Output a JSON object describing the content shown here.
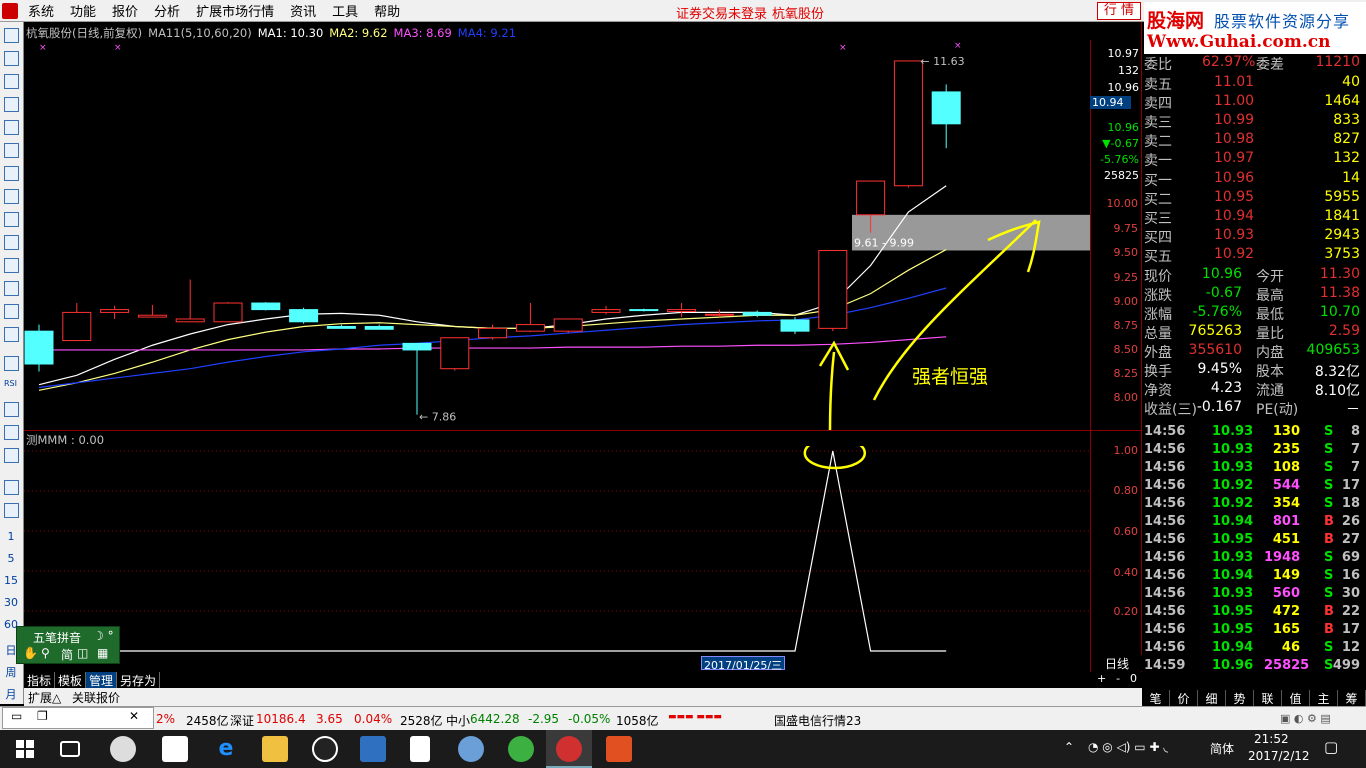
{
  "menu": {
    "items": [
      "系统",
      "功能",
      "报价",
      "分析",
      "扩展市场行情",
      "资讯",
      "工具",
      "帮助"
    ],
    "notice": "证券交易未登录",
    "stock_name": "杭氧股份",
    "quote_button": "行 情"
  },
  "brand": {
    "line1": "股海网",
    "line2": "股票软件资源分享",
    "line3": "Www.Guhai.com.cn"
  },
  "chart": {
    "title": "杭氧股份(日线,前复权)",
    "ma_params": "MA11(5,10,60,20)",
    "ma1": "MA1: 10.30",
    "ma2": "MA2: 9.62",
    "ma3": "MA3: 8.69",
    "ma4": "MA4: 9.21",
    "high_label": "11.63",
    "low_label": "7.86",
    "zone_label": "9.61 - 9.99",
    "annotation": "强者恒强",
    "price_box": [
      "10.97",
      "132",
      "10.96",
      "10.94",
      "10.96",
      "▼-0.67",
      "-5.76%",
      "25825"
    ],
    "y_axis": [
      "10.00",
      "9.75",
      "9.50",
      "9.25",
      "9.00",
      "8.75",
      "8.50",
      "8.25",
      "8.00"
    ],
    "sub_title": "测MMM : 0.00",
    "sub_y_axis": [
      "1.00",
      "0.80",
      "0.60",
      "0.40",
      "0.20"
    ],
    "date_cursor": "2017/01/25/三",
    "period": "日线",
    "colors": {
      "up": "#ff3232",
      "down": "#54ffff",
      "ma1": "#ffffff",
      "ma2": "#ffff80",
      "ma3": "#ff50ff",
      "ma4": "#2040ff",
      "accent": "#ffff00",
      "zone": "#999999"
    }
  },
  "chart_data": {
    "type": "candlestick",
    "title": "",
    "candles": [
      {
        "o": 8.75,
        "h": 8.82,
        "l": 8.32,
        "c": 8.4
      },
      {
        "o": 8.65,
        "h": 9.05,
        "l": 8.65,
        "c": 8.95
      },
      {
        "o": 8.95,
        "h": 9.02,
        "l": 8.88,
        "c": 8.98
      },
      {
        "o": 8.9,
        "h": 9.03,
        "l": 8.9,
        "c": 8.92
      },
      {
        "o": 8.85,
        "h": 9.3,
        "l": 8.85,
        "c": 8.88
      },
      {
        "o": 8.85,
        "h": 9.06,
        "l": 8.85,
        "c": 9.05
      },
      {
        "o": 9.05,
        "h": 9.06,
        "l": 8.97,
        "c": 8.98
      },
      {
        "o": 8.98,
        "h": 9.0,
        "l": 8.83,
        "c": 8.85
      },
      {
        "o": 8.8,
        "h": 8.82,
        "l": 8.78,
        "c": 8.78
      },
      {
        "o": 8.8,
        "h": 8.82,
        "l": 8.78,
        "c": 8.77
      },
      {
        "o": 8.62,
        "h": 8.62,
        "l": 7.86,
        "c": 8.55
      },
      {
        "o": 8.35,
        "h": 8.67,
        "l": 8.33,
        "c": 8.68
      },
      {
        "o": 8.68,
        "h": 8.82,
        "l": 8.66,
        "c": 8.78
      },
      {
        "o": 8.75,
        "h": 9.05,
        "l": 8.74,
        "c": 8.82
      },
      {
        "o": 8.75,
        "h": 8.88,
        "l": 8.73,
        "c": 8.88
      },
      {
        "o": 8.95,
        "h": 9.02,
        "l": 8.93,
        "c": 8.98
      },
      {
        "o": 8.98,
        "h": 8.99,
        "l": 8.96,
        "c": 8.97
      },
      {
        "o": 8.96,
        "h": 9.05,
        "l": 8.9,
        "c": 8.98
      },
      {
        "o": 8.92,
        "h": 8.98,
        "l": 8.9,
        "c": 8.93
      },
      {
        "o": 8.95,
        "h": 8.97,
        "l": 8.9,
        "c": 8.92
      },
      {
        "o": 8.87,
        "h": 8.9,
        "l": 8.72,
        "c": 8.75
      },
      {
        "o": 8.78,
        "h": 9.61,
        "l": 8.75,
        "c": 9.61
      },
      {
        "o": 9.99,
        "h": 10.35,
        "l": 9.8,
        "c": 10.35
      },
      {
        "o": 10.3,
        "h": 11.63,
        "l": 10.28,
        "c": 11.63
      },
      {
        "o": 11.3,
        "h": 11.38,
        "l": 10.7,
        "c": 10.96
      }
    ],
    "series": [
      {
        "name": "MA1",
        "values": [
          8.18,
          8.28,
          8.45,
          8.6,
          8.72,
          8.82,
          8.88,
          8.93,
          8.94,
          8.92,
          8.85,
          8.8,
          8.78,
          8.78,
          8.82,
          8.88,
          8.92,
          8.95,
          8.95,
          8.95,
          8.92,
          9.05,
          9.45,
          10.02,
          10.3
        ]
      },
      {
        "name": "MA2",
        "values": [
          8.12,
          8.2,
          8.3,
          8.42,
          8.55,
          8.66,
          8.74,
          8.8,
          8.83,
          8.84,
          8.82,
          8.8,
          8.78,
          8.78,
          8.8,
          8.83,
          8.86,
          8.88,
          8.9,
          8.92,
          8.92,
          8.98,
          9.15,
          9.4,
          9.62
        ]
      },
      {
        "name": "MA3",
        "values": [
          8.55,
          8.55,
          8.55,
          8.55,
          8.55,
          8.55,
          8.55,
          8.55,
          8.56,
          8.56,
          8.57,
          8.57,
          8.57,
          8.57,
          8.58,
          8.58,
          8.58,
          8.59,
          8.59,
          8.6,
          8.6,
          8.61,
          8.63,
          8.66,
          8.69
        ]
      },
      {
        "name": "MA4",
        "values": [
          8.15,
          8.2,
          8.25,
          8.3,
          8.35,
          8.42,
          8.48,
          8.53,
          8.56,
          8.6,
          8.62,
          8.65,
          8.68,
          8.7,
          8.73,
          8.76,
          8.79,
          8.82,
          8.84,
          8.86,
          8.87,
          8.92,
          9.0,
          9.1,
          9.21
        ]
      }
    ],
    "zone": [
      9.61,
      9.99
    ],
    "indicator": {
      "name": "测MMM",
      "values": [
        0,
        0,
        0,
        0,
        0,
        0,
        0,
        0,
        0,
        0,
        0,
        0,
        0,
        0,
        0,
        0,
        0,
        0,
        0,
        0,
        0,
        1,
        0,
        0,
        0
      ]
    },
    "ylim": [
      7.75,
      11.8
    ]
  },
  "quote": {
    "wei": {
      "label": "委比",
      "value": "62.97%",
      "label2": "委差",
      "value2": "11210"
    },
    "sell": [
      {
        "label": "卖五",
        "price": "11.01",
        "vol": "40"
      },
      {
        "label": "卖四",
        "price": "11.00",
        "vol": "1464"
      },
      {
        "label": "卖三",
        "price": "10.99",
        "vol": "833"
      },
      {
        "label": "卖二",
        "price": "10.98",
        "vol": "827"
      },
      {
        "label": "卖一",
        "price": "10.97",
        "vol": "132"
      }
    ],
    "buy": [
      {
        "label": "买一",
        "price": "10.96",
        "vol": "14"
      },
      {
        "label": "买二",
        "price": "10.95",
        "vol": "5955"
      },
      {
        "label": "买三",
        "price": "10.94",
        "vol": "1841"
      },
      {
        "label": "买四",
        "price": "10.93",
        "vol": "2943"
      },
      {
        "label": "买五",
        "price": "10.92",
        "vol": "3753"
      }
    ],
    "stats": [
      {
        "l1": "现价",
        "v1": "10.96",
        "l2": "今开",
        "v2": "11.30"
      },
      {
        "l1": "涨跌",
        "v1": "-0.67",
        "l2": "最高",
        "v2": "11.38"
      },
      {
        "l1": "涨幅",
        "v1": "-5.76%",
        "l2": "最低",
        "v2": "10.70"
      },
      {
        "l1": "总量",
        "v1": "765263",
        "l2": "量比",
        "v2": "2.59"
      },
      {
        "l1": "外盘",
        "v1": "355610",
        "l2": "内盘",
        "v2": "409653"
      },
      {
        "l1": "换手",
        "v1": "9.45%",
        "l2": "股本",
        "v2": "8.32亿"
      },
      {
        "l1": "净资",
        "v1": "4.23",
        "l2": "流通",
        "v2": "8.10亿"
      },
      {
        "l1": "收益(三)",
        "v1": "-0.167",
        "l2": "PE(动)",
        "v2": "－"
      }
    ],
    "ticks": [
      {
        "t": "14:56",
        "p": "10.93",
        "v": "130",
        "bs": "S",
        "c": "8"
      },
      {
        "t": "14:56",
        "p": "10.93",
        "v": "235",
        "bs": "S",
        "c": "7"
      },
      {
        "t": "14:56",
        "p": "10.93",
        "v": "108",
        "bs": "S",
        "c": "7"
      },
      {
        "t": "14:56",
        "p": "10.92",
        "v": "544",
        "bs": "S",
        "c": "17"
      },
      {
        "t": "14:56",
        "p": "10.92",
        "v": "354",
        "bs": "S",
        "c": "18"
      },
      {
        "t": "14:56",
        "p": "10.94",
        "v": "801",
        "bs": "B",
        "c": "26"
      },
      {
        "t": "14:56",
        "p": "10.95",
        "v": "451",
        "bs": "B",
        "c": "27"
      },
      {
        "t": "14:56",
        "p": "10.93",
        "v": "1948",
        "bs": "S",
        "c": "69"
      },
      {
        "t": "14:56",
        "p": "10.94",
        "v": "149",
        "bs": "S",
        "c": "16"
      },
      {
        "t": "14:56",
        "p": "10.93",
        "v": "560",
        "bs": "S",
        "c": "30"
      },
      {
        "t": "14:56",
        "p": "10.95",
        "v": "472",
        "bs": "B",
        "c": "22"
      },
      {
        "t": "14:56",
        "p": "10.95",
        "v": "165",
        "bs": "B",
        "c": "17"
      },
      {
        "t": "14:56",
        "p": "10.94",
        "v": "46",
        "bs": "S",
        "c": "12"
      },
      {
        "t": "14:59",
        "p": "10.96",
        "v": "25825",
        "bs": "S",
        "c": "499"
      }
    ],
    "tabs": [
      "笔",
      "价",
      "细",
      "势",
      "联",
      "值",
      "主",
      "筹"
    ]
  },
  "left_tool": {
    "numbers": [
      "1",
      "5",
      "15",
      "30",
      "60",
      "日",
      "周",
      "月"
    ]
  },
  "ime": {
    "name": "五笔拼音",
    "mode": "简"
  },
  "bottom": {
    "tabs": [
      "指标",
      "模板",
      "管理",
      "另存为"
    ],
    "sub_tabs": [
      "扩展△",
      "关联报价"
    ],
    "zoom": [
      "+",
      "-",
      "0"
    ]
  },
  "status": {
    "sh_pct": "2%",
    "sh_amt": "2458亿",
    "sz_label": "深证",
    "sz_val": "10186.4",
    "sz_chg": "3.65",
    "sz_pct": "0.04%",
    "sz_amt": "2528亿",
    "zx_label": "中小",
    "zx_val": "6442.28",
    "zx_chg": "-2.95",
    "zx_pct": "-0.05%",
    "zx_amt": "1058亿",
    "server": "国盛电信行情23"
  },
  "taskbar": {
    "ime": "简体",
    "time": "21:52",
    "date": "2017/2/12"
  }
}
